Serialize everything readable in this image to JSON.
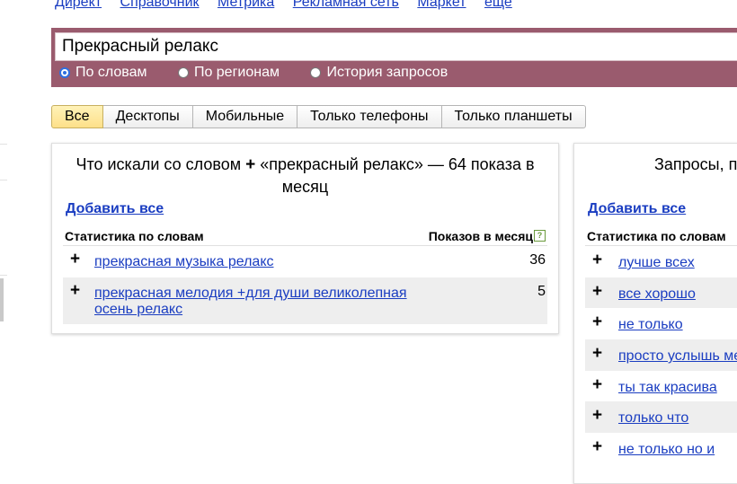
{
  "topnav": {
    "items": [
      "Директ",
      "Справочник",
      "Метрика",
      "Рекламная сеть",
      "Маркет",
      "еще"
    ]
  },
  "search": {
    "value": "Прекрасный релакс",
    "radios": [
      {
        "label": "По словам",
        "checked": true
      },
      {
        "label": "По регионам",
        "checked": false
      },
      {
        "label": "История запросов",
        "checked": false
      }
    ]
  },
  "tabs": [
    "Все",
    "Десктопы",
    "Мобильные",
    "Только телефоны",
    "Только планшеты"
  ],
  "left_panel": {
    "title_part1": "Что искали со словом",
    "plus": "+",
    "title_part2": "«прекрасный релакс» — 64 показа в месяц",
    "add_all": "Добавить все",
    "col_words": "Статистика по словам",
    "col_shows": "Показов в месяц",
    "help": "?",
    "rows": [
      {
        "plus": "+",
        "phrase": "прекрасная музыка релакс",
        "count": "36"
      },
      {
        "plus": "+",
        "phrase": "прекрасная мелодия +для души великолепная осень релакс",
        "count": "5"
      }
    ]
  },
  "right_panel": {
    "title": "Запросы, п",
    "add_all": "Добавить все",
    "col_words": "Статистика по словам",
    "rows": [
      {
        "plus": "+",
        "phrase": "лучше всех"
      },
      {
        "plus": "+",
        "phrase": "все хорошо"
      },
      {
        "plus": "+",
        "phrase": "не только"
      },
      {
        "plus": "+",
        "phrase": "просто услышь ме"
      },
      {
        "plus": "+",
        "phrase": "ты так красива"
      },
      {
        "plus": "+",
        "phrase": "только что"
      },
      {
        "plus": "+",
        "phrase": "не только но и"
      }
    ]
  },
  "colors": {
    "search_band": "#9a5b6e",
    "link": "#1a3dc1",
    "active_tab": "#fde089"
  }
}
